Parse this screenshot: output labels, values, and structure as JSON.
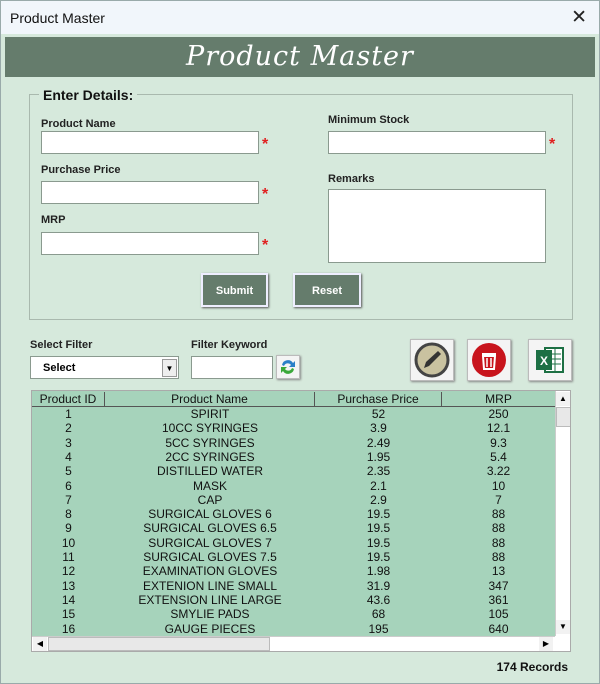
{
  "window": {
    "title": "Product Master",
    "close": "✕"
  },
  "banner": {
    "title": "Product Master"
  },
  "form": {
    "legend": "Enter Details:",
    "product_name": {
      "label": "Product Name",
      "value": ""
    },
    "purchase_price": {
      "label": "Purchase Price",
      "value": ""
    },
    "mrp": {
      "label": "MRP",
      "value": ""
    },
    "minimum_stock": {
      "label": "Minimum Stock",
      "value": ""
    },
    "remarks": {
      "label": "Remarks",
      "value": ""
    },
    "required_marker": "*",
    "submit": "Submit",
    "reset": "Reset"
  },
  "filter": {
    "select_label": "Select Filter",
    "select_value": "Select",
    "keyword_label": "Filter Keyword",
    "keyword_value": ""
  },
  "table": {
    "columns": [
      "Product ID",
      "Product Name",
      "Purchase Price",
      "MRP"
    ],
    "rows": [
      [
        "1",
        "SPIRIT",
        "52",
        "250"
      ],
      [
        "2",
        "10CC SYRINGES",
        "3.9",
        "12.1"
      ],
      [
        "3",
        "5CC SYRINGES",
        "2.49",
        "9.3"
      ],
      [
        "4",
        "2CC SYRINGES",
        "1.95",
        "5.4"
      ],
      [
        "5",
        "DISTILLED WATER",
        "2.35",
        "3.22"
      ],
      [
        "6",
        "MASK",
        "2.1",
        "10"
      ],
      [
        "7",
        "CAP",
        "2.9",
        "7"
      ],
      [
        "8",
        "SURGICAL GLOVES 6",
        "19.5",
        "88"
      ],
      [
        "9",
        "SURGICAL GLOVES 6.5",
        "19.5",
        "88"
      ],
      [
        "10",
        "SURGICAL GLOVES 7",
        "19.5",
        "88"
      ],
      [
        "11",
        "SURGICAL GLOVES 7.5",
        "19.5",
        "88"
      ],
      [
        "12",
        "EXAMINATION GLOVES",
        "1.98",
        "13"
      ],
      [
        "13",
        "EXTENION LINE SMALL",
        "31.9",
        "347"
      ],
      [
        "14",
        "EXTENSION LINE LARGE",
        "43.6",
        "361"
      ],
      [
        "15",
        "SMYLIE PADS",
        "68",
        "105"
      ],
      [
        "16",
        "GAUGE PIECES",
        "195",
        "640"
      ]
    ]
  },
  "records": "174 Records",
  "colors": {
    "banner": "#657c6c",
    "background": "#d6e9dc",
    "grid": "#a6d3bb",
    "required": "#e02020"
  },
  "icons": [
    "edit-pencil-icon",
    "delete-trash-icon",
    "excel-export-icon",
    "refresh-icon"
  ]
}
